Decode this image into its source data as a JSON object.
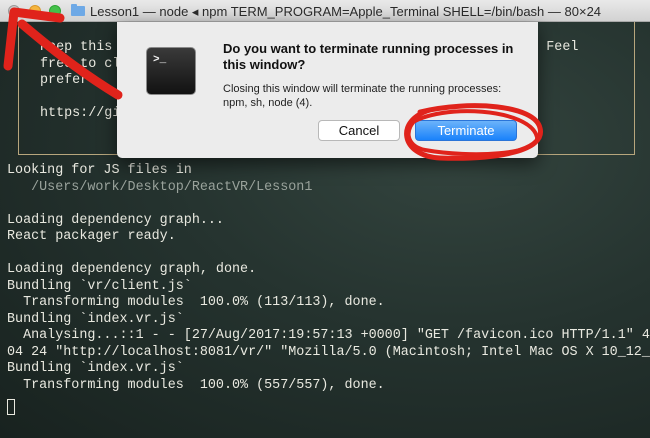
{
  "window": {
    "title": "Lesson1 — node ◂ npm TERM_PROGRAM=Apple_Terminal SHELL=/bin/bash — 80×24"
  },
  "terminal": {
    "box_lines": [
      "Keep this                                                    . Feel",
      "free to cl                                                  ou",
      "prefer.",
      "",
      "https://gi"
    ],
    "lines": [
      {
        "text": "Looking for JS files in",
        "dim": false
      },
      {
        "text": "   /Users/work/Desktop/ReactVR/Lesson1",
        "dim": true
      },
      {
        "text": "",
        "dim": false
      },
      {
        "text": "Loading dependency graph...",
        "dim": false
      },
      {
        "text": "React packager ready.",
        "dim": false
      },
      {
        "text": "",
        "dim": false
      },
      {
        "text": "Loading dependency graph, done.",
        "dim": false
      },
      {
        "text": "Bundling `vr/client.js`",
        "dim": false
      },
      {
        "text": "  Transforming modules  100.0% (113/113), done.",
        "dim": false
      },
      {
        "text": "Bundling `index.vr.js`",
        "dim": false
      },
      {
        "text": "  Analysing...::1 - - [27/Aug/2017:19:57:13 +0000] \"GET /favicon.ico HTTP/1.1\" 4",
        "dim": false
      },
      {
        "text": "04 24 \"http://localhost:8081/vr/\" \"Mozilla/5.0 (Macintosh; Intel Mac OS X 10_12_",
        "dim": false
      },
      {
        "text": "Bundling `index.vr.js`",
        "dim": false
      },
      {
        "text": "  Transforming modules  100.0% (557/557), done.",
        "dim": false
      }
    ]
  },
  "dialog": {
    "icon_glyph": ">_",
    "title": "Do you want to terminate running processes in this window?",
    "message": "Closing this window will terminate the running processes: npm, sh, node (4).",
    "cancel_label": "Cancel",
    "terminate_label": "Terminate"
  },
  "annotations": {
    "color": "#e0231b"
  }
}
